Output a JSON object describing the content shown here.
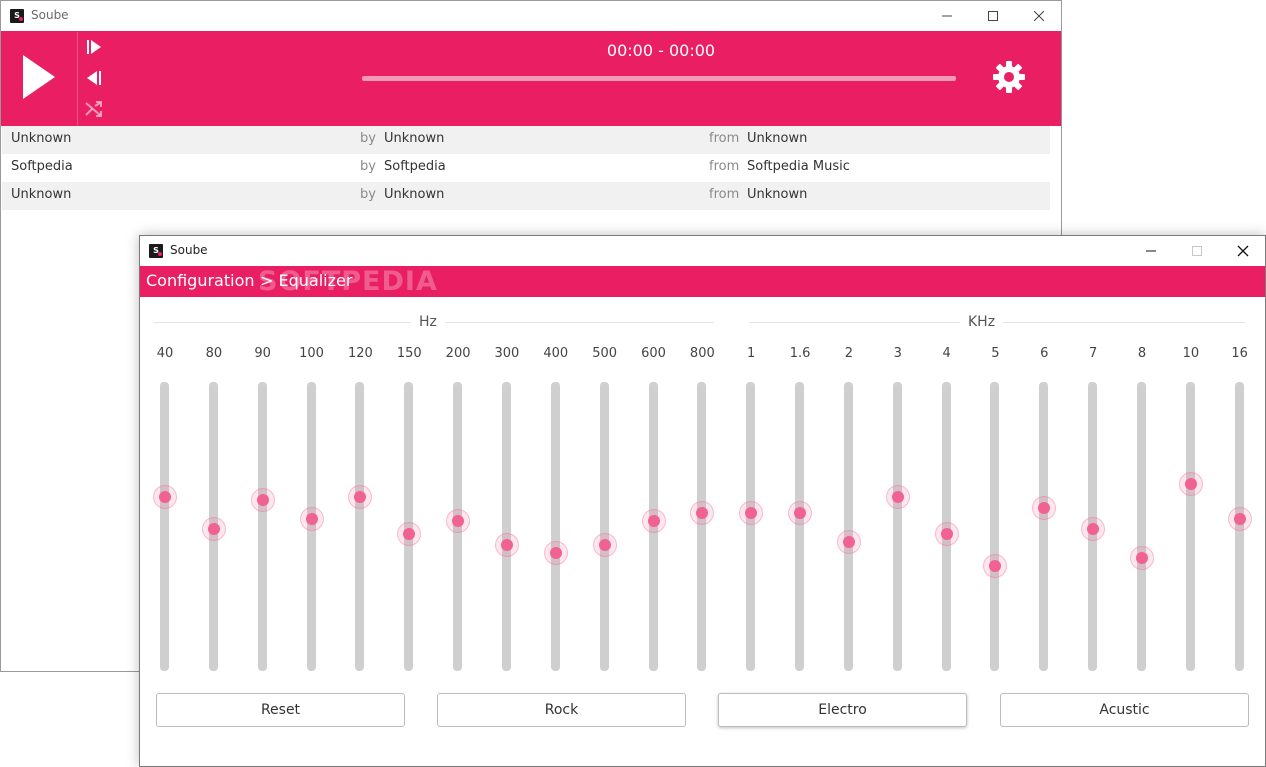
{
  "main_window": {
    "title": "Soube",
    "time": "00:00 - 00:00",
    "progress": 0.0,
    "controls": {
      "play_icon": "play-icon",
      "next_icon": "skip-next-icon",
      "prev_icon": "skip-previous-icon",
      "shuffle_icon": "shuffle-icon",
      "settings_icon": "gear-icon"
    },
    "tracks": [
      {
        "title": "Unknown",
        "by": "by",
        "artist": "Unknown",
        "from": "from",
        "album": "Unknown"
      },
      {
        "title": "Softpedia",
        "by": "by",
        "artist": "Softpedia",
        "from": "from",
        "album": "Softpedia Music"
      },
      {
        "title": "Unknown",
        "by": "by",
        "artist": "Unknown",
        "from": "from",
        "album": "Unknown"
      }
    ]
  },
  "eq_window": {
    "title": "Soube",
    "breadcrumb": {
      "root": "Configuration",
      "current": "> Equalizer"
    },
    "watermark": "SOFTPEDIA",
    "groups": {
      "hz": "Hz",
      "khz": "KHz"
    },
    "bands": [
      {
        "label": "40",
        "level": 0.61
      },
      {
        "label": "80",
        "level": 0.49
      },
      {
        "label": "90",
        "level": 0.6
      },
      {
        "label": "100",
        "level": 0.53
      },
      {
        "label": "120",
        "level": 0.61
      },
      {
        "label": "150",
        "level": 0.47
      },
      {
        "label": "200",
        "level": 0.52
      },
      {
        "label": "300",
        "level": 0.43
      },
      {
        "label": "400",
        "level": 0.4
      },
      {
        "label": "500",
        "level": 0.43
      },
      {
        "label": "600",
        "level": 0.52
      },
      {
        "label": "800",
        "level": 0.55
      },
      {
        "label": "1",
        "level": 0.55
      },
      {
        "label": "1.6",
        "level": 0.55
      },
      {
        "label": "2",
        "level": 0.44
      },
      {
        "label": "3",
        "level": 0.61
      },
      {
        "label": "4",
        "level": 0.47
      },
      {
        "label": "5",
        "level": 0.35
      },
      {
        "label": "6",
        "level": 0.57
      },
      {
        "label": "7",
        "level": 0.49
      },
      {
        "label": "8",
        "level": 0.38
      },
      {
        "label": "10",
        "level": 0.66
      },
      {
        "label": "16",
        "level": 0.53
      }
    ],
    "presets": [
      {
        "label": "Reset",
        "active": false
      },
      {
        "label": "Rock",
        "active": false
      },
      {
        "label": "Electro",
        "active": true
      },
      {
        "label": "Acustic",
        "active": false
      }
    ]
  },
  "colors": {
    "accent": "#e91e63",
    "thumb": "#f06292",
    "track": "#cfcfcf"
  }
}
